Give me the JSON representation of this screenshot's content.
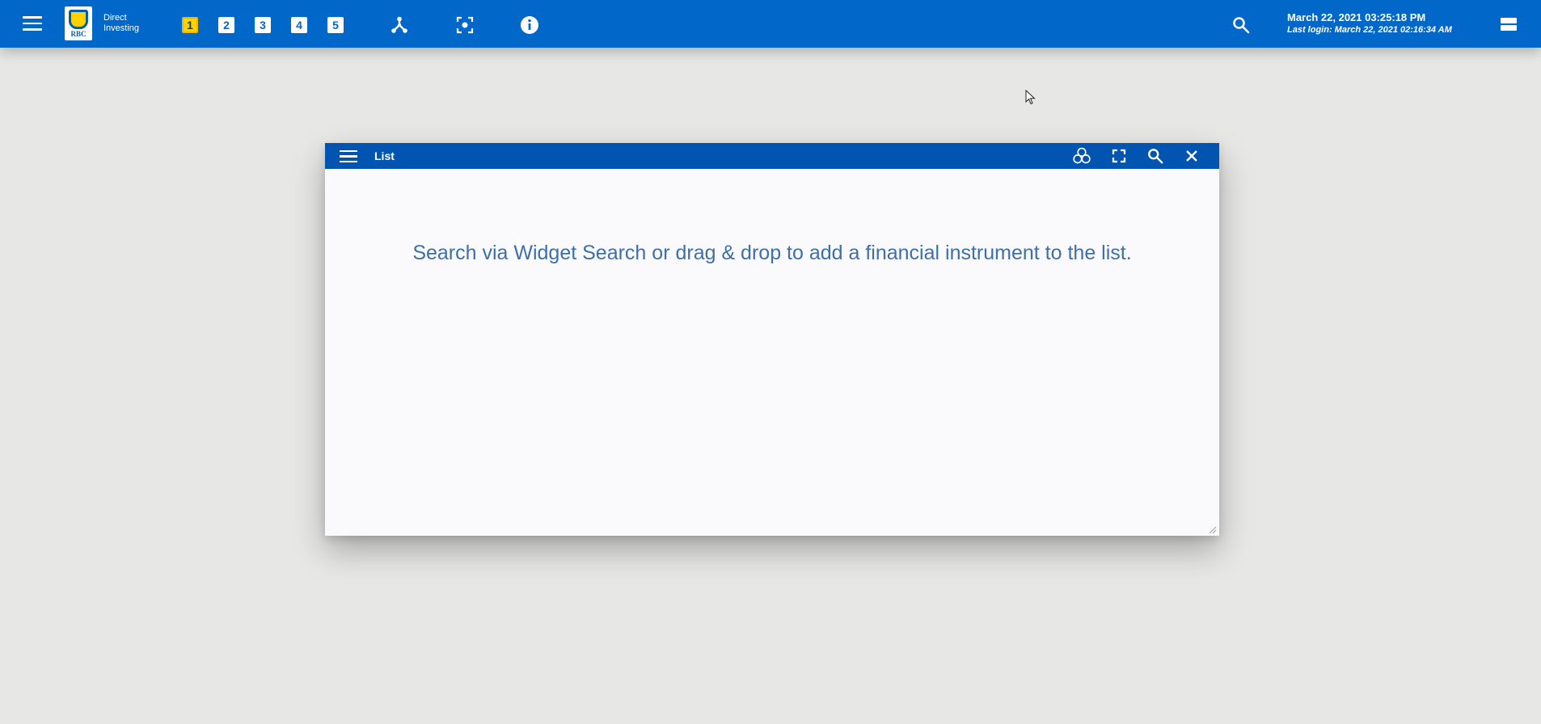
{
  "topbar": {
    "logo": {
      "line1": "Direct",
      "line2": "Investing",
      "badge": "RBC"
    },
    "workspaces": [
      {
        "label": "1",
        "active": true
      },
      {
        "label": "2",
        "active": false
      },
      {
        "label": "3",
        "active": false
      },
      {
        "label": "4",
        "active": false
      },
      {
        "label": "5",
        "active": false
      }
    ],
    "icons": [
      "menu-icon",
      "network-icon",
      "focus-icon",
      "info-icon",
      "search-icon",
      "layout-icon"
    ],
    "datetime": "March 22, 2021 03:25:18 PM",
    "last_login": "Last login: March 22, 2021 02:16:34 AM"
  },
  "widget": {
    "title": "List",
    "header_icons": [
      "menu-icon",
      "link-circles-icon",
      "maximize-icon",
      "search-icon",
      "close-icon"
    ],
    "empty_message": "Search via Widget Search or drag & drop to add a financial instrument to the list."
  },
  "colors": {
    "topbar": "#0167c8",
    "widget_header": "#0155b0",
    "active_workspace": "#ffd200",
    "background": "#e7e7e6",
    "message_text": "#3e6fa8"
  }
}
